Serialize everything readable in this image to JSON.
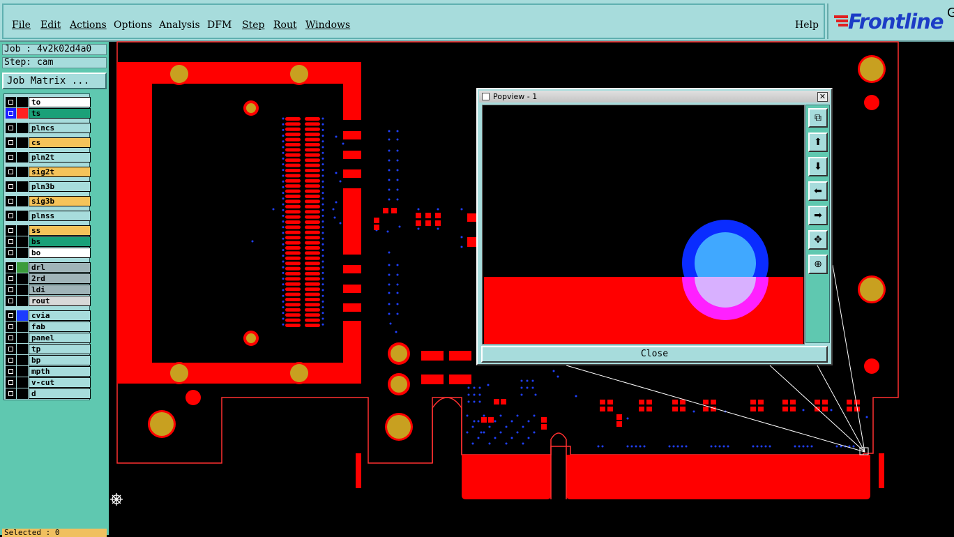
{
  "menubar": {
    "items": [
      "File",
      "Edit",
      "Actions",
      "Options",
      "Analysis",
      "DFM",
      "Step",
      "Rout",
      "Windows"
    ],
    "help": "Help",
    "logo_text": "Frontline",
    "logo_suffix": "G"
  },
  "job": {
    "job_label": "Job : 4v2k02d4a0",
    "step_label": "Step: cam",
    "matrix_button": "Job Matrix ..."
  },
  "layers": [
    {
      "name": "to",
      "color": "#ffffff",
      "swatch": "#000000",
      "group": 0
    },
    {
      "name": "ts",
      "color": "#1aa078",
      "swatch": "#ff2020",
      "group": 0,
      "active": true
    },
    {
      "name": "plncs",
      "color": "#a7dcdc",
      "swatch": "#000000",
      "group": 1
    },
    {
      "name": "cs",
      "color": "#f5c35a",
      "swatch": "#000000",
      "group": 1
    },
    {
      "name": "pln2t",
      "color": "#a7dcdc",
      "swatch": "#000000",
      "group": 1
    },
    {
      "name": "sig2t",
      "color": "#f5c35a",
      "swatch": "#000000",
      "group": 1
    },
    {
      "name": "pln3b",
      "color": "#a7dcdc",
      "swatch": "#000000",
      "group": 1
    },
    {
      "name": "sig3b",
      "color": "#f5c35a",
      "swatch": "#000000",
      "group": 1
    },
    {
      "name": "plnss",
      "color": "#a7dcdc",
      "swatch": "#000000",
      "group": 1
    },
    {
      "name": "ss",
      "color": "#f5c35a",
      "swatch": "#000000",
      "group": 2
    },
    {
      "name": "bs",
      "color": "#1aa078",
      "swatch": "#000000",
      "group": 2
    },
    {
      "name": "bo",
      "color": "#ffffff",
      "swatch": "#000000",
      "group": 2
    },
    {
      "name": "drl",
      "color": "#a0b4b8",
      "swatch": "#3c9c3c",
      "group": 3
    },
    {
      "name": "2rd",
      "color": "#a0b4b8",
      "swatch": "#000000",
      "group": 3
    },
    {
      "name": "ldi",
      "color": "#a0b4b8",
      "swatch": "#000000",
      "group": 3
    },
    {
      "name": "rout",
      "color": "#d8d8d8",
      "swatch": "#000000",
      "group": 3
    },
    {
      "name": "cvia",
      "color": "#a7dcdc",
      "swatch": "#1c3cff",
      "group": 4
    },
    {
      "name": "fab",
      "color": "#a7dcdc",
      "swatch": "#000000",
      "group": 4
    },
    {
      "name": "panel",
      "color": "#a7dcdc",
      "swatch": "#000000",
      "group": 4
    },
    {
      "name": "tp",
      "color": "#a7dcdc",
      "swatch": "#000000",
      "group": 4
    },
    {
      "name": "bp",
      "color": "#a7dcdc",
      "swatch": "#000000",
      "group": 4
    },
    {
      "name": "mpth",
      "color": "#a7dcdc",
      "swatch": "#000000",
      "group": 4
    },
    {
      "name": "v-cut",
      "color": "#a7dcdc",
      "swatch": "#000000",
      "group": 4
    },
    {
      "name": "d",
      "color": "#a7dcdc",
      "swatch": "#000000",
      "group": 4
    }
  ],
  "status": {
    "selected": "Selected : 0"
  },
  "popview": {
    "title": "Popview - 1",
    "close_label": "Close",
    "tools": [
      "zoom-window-icon",
      "pan-up-icon",
      "pan-down-icon",
      "pan-left-icon",
      "pan-right-icon",
      "zoom-fit-icon",
      "zoom-home-icon"
    ]
  },
  "colors": {
    "copper": "#ff0000",
    "pad": "#c8a020",
    "via": "#1c3cff",
    "panel_bg": "#a7dcdc",
    "accent": "#5fc8b0"
  }
}
